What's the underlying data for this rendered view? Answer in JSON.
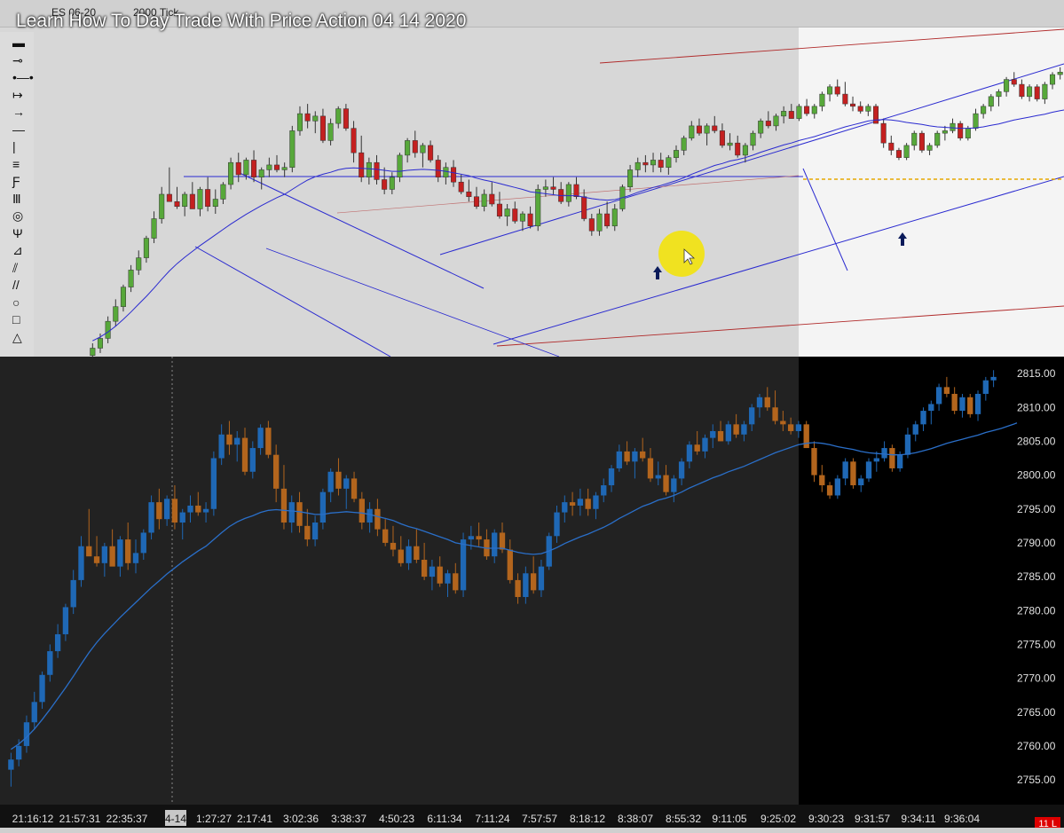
{
  "video_title": "Learn How To Day Trade With Price Action 04 14 2020",
  "toolbar": {
    "instrument": "ES 06-20",
    "bar_type": "2000 Tick"
  },
  "drawing_tools": [
    "rectangle-tool",
    "line-tool",
    "ray-tool",
    "extended-line-tool",
    "arrow-line-tool",
    "horizontal-line-tool",
    "vertical-line-tool",
    "channel-tool",
    "fib-retracement-tool",
    "fib-extension-tool",
    "fib-circle-tool",
    "andrews-pitchfork-tool",
    "gann-fan-tool",
    "regression-tool",
    "parallel-lines-tool",
    "ellipse-tool",
    "rectangle-shape-tool",
    "triangle-tool"
  ],
  "chart_data": {
    "type": "candlestick",
    "title": "",
    "price_axis": {
      "labels": [
        "2815.00",
        "2810.00",
        "2805.00",
        "2800.00",
        "2795.00",
        "2790.00",
        "2785.00",
        "2780.00",
        "2775.00",
        "2770.00",
        "2765.00",
        "2760.00",
        "2755.00"
      ],
      "ylim": [
        2752.0,
        2817.5
      ]
    },
    "time_axis": {
      "labels": [
        "21:16:12",
        "21:57:31",
        "22:35:37",
        "4-14",
        "1:27:27",
        "2:17:41",
        "3:02:36",
        "3:38:37",
        "4:50:23",
        "6:11:34",
        "7:11:24",
        "7:57:57",
        "8:18:12",
        "8:38:07",
        "8:55:32",
        "9:11:05",
        "9:25:02",
        "9:30:23",
        "9:31:57",
        "9:34:11",
        "9:36:04"
      ],
      "highlighted": "4-14"
    },
    "session_break_index": 84,
    "colors": {
      "up": "#1f68b5",
      "down": "#b3651d",
      "ma": "#2a6fc9",
      "session_bg": "#000000"
    },
    "candles": [
      [
        2756.5,
        2759.0,
        2754.0,
        2758.0
      ],
      [
        2758.0,
        2761.0,
        2757.0,
        2760.0
      ],
      [
        2760.0,
        2764.5,
        2759.0,
        2763.5
      ],
      [
        2763.5,
        2768.0,
        2762.5,
        2766.5
      ],
      [
        2766.5,
        2771.0,
        2765.5,
        2770.5
      ],
      [
        2770.5,
        2775.0,
        2769.5,
        2774.0
      ],
      [
        2774.0,
        2778.0,
        2773.0,
        2776.5
      ],
      [
        2776.5,
        2781.0,
        2775.5,
        2780.5
      ],
      [
        2780.5,
        2786.0,
        2779.5,
        2784.5
      ],
      [
        2784.5,
        2791.0,
        2783.5,
        2789.5
      ],
      [
        2789.5,
        2795.0,
        2788.5,
        2788.0
      ],
      [
        2788.0,
        2791.0,
        2786.5,
        2787.0
      ],
      [
        2787.0,
        2790.0,
        2785.0,
        2789.5
      ],
      [
        2789.5,
        2792.0,
        2787.0,
        2786.5
      ],
      [
        2786.5,
        2791.0,
        2785.0,
        2790.5
      ],
      [
        2790.5,
        2793.0,
        2786.0,
        2787.0
      ],
      [
        2787.0,
        2790.5,
        2785.5,
        2788.5
      ],
      [
        2788.5,
        2792.0,
        2787.5,
        2791.5
      ],
      [
        2791.5,
        2797.0,
        2790.5,
        2796.0
      ],
      [
        2796.0,
        2798.0,
        2792.0,
        2793.5
      ],
      [
        2793.5,
        2797.0,
        2792.5,
        2796.5
      ],
      [
        2796.5,
        2798.5,
        2792.0,
        2793.0
      ],
      [
        2793.0,
        2795.0,
        2790.5,
        2794.5
      ],
      [
        2794.5,
        2797.0,
        2793.0,
        2795.5
      ],
      [
        2795.5,
        2797.5,
        2794.0,
        2794.5
      ],
      [
        2794.5,
        2796.0,
        2793.0,
        2795.0
      ],
      [
        2795.0,
        2803.5,
        2794.0,
        2802.5
      ],
      [
        2802.5,
        2807.5,
        2801.5,
        2806.0
      ],
      [
        2806.0,
        2808.0,
        2803.0,
        2804.5
      ],
      [
        2804.5,
        2806.5,
        2802.0,
        2805.5
      ],
      [
        2805.5,
        2807.0,
        2800.0,
        2800.5
      ],
      [
        2800.5,
        2805.0,
        2799.5,
        2804.0
      ],
      [
        2804.0,
        2807.5,
        2803.0,
        2807.0
      ],
      [
        2807.0,
        2808.0,
        2802.5,
        2803.0
      ],
      [
        2803.0,
        2804.5,
        2796.0,
        2798.0
      ],
      [
        2798.0,
        2801.5,
        2792.0,
        2793.0
      ],
      [
        2793.0,
        2797.0,
        2791.5,
        2796.0
      ],
      [
        2796.0,
        2797.5,
        2791.5,
        2792.5
      ],
      [
        2792.5,
        2795.0,
        2789.5,
        2790.5
      ],
      [
        2790.5,
        2794.0,
        2789.5,
        2793.0
      ],
      [
        2793.0,
        2798.0,
        2792.0,
        2797.5
      ],
      [
        2797.5,
        2801.0,
        2796.0,
        2800.5
      ],
      [
        2800.5,
        2802.5,
        2797.0,
        2798.0
      ],
      [
        2798.0,
        2800.0,
        2795.0,
        2799.5
      ],
      [
        2799.5,
        2800.5,
        2796.0,
        2796.5
      ],
      [
        2796.5,
        2797.5,
        2792.0,
        2793.0
      ],
      [
        2793.0,
        2796.0,
        2791.5,
        2795.0
      ],
      [
        2795.0,
        2796.5,
        2791.0,
        2792.0
      ],
      [
        2792.0,
        2793.5,
        2789.5,
        2790.0
      ],
      [
        2790.0,
        2792.5,
        2788.0,
        2789.0
      ],
      [
        2789.0,
        2791.0,
        2786.5,
        2787.0
      ],
      [
        2787.0,
        2790.5,
        2786.0,
        2789.5
      ],
      [
        2789.5,
        2792.0,
        2787.0,
        2787.5
      ],
      [
        2787.5,
        2790.0,
        2784.5,
        2785.0
      ],
      [
        2785.0,
        2787.5,
        2783.0,
        2786.5
      ],
      [
        2786.5,
        2788.0,
        2783.5,
        2784.0
      ],
      [
        2784.0,
        2786.0,
        2782.0,
        2785.5
      ],
      [
        2785.5,
        2787.0,
        2782.5,
        2783.0
      ],
      [
        2783.0,
        2791.5,
        2782.0,
        2790.5
      ],
      [
        2790.5,
        2792.5,
        2789.0,
        2791.0
      ],
      [
        2791.0,
        2793.0,
        2789.5,
        2790.5
      ],
      [
        2790.5,
        2792.0,
        2787.5,
        2788.0
      ],
      [
        2788.0,
        2792.0,
        2787.0,
        2791.5
      ],
      [
        2791.5,
        2793.0,
        2788.5,
        2789.0
      ],
      [
        2789.0,
        2790.5,
        2784.0,
        2784.5
      ],
      [
        2784.5,
        2785.5,
        2781.0,
        2782.0
      ],
      [
        2782.0,
        2786.5,
        2781.0,
        2785.5
      ],
      [
        2785.5,
        2788.0,
        2782.5,
        2783.0
      ],
      [
        2783.0,
        2787.5,
        2782.0,
        2786.5
      ],
      [
        2786.5,
        2791.5,
        2786.0,
        2791.0
      ],
      [
        2791.0,
        2795.5,
        2790.0,
        2794.5
      ],
      [
        2794.5,
        2797.0,
        2793.0,
        2796.0
      ],
      [
        2796.0,
        2797.5,
        2794.0,
        2795.5
      ],
      [
        2795.5,
        2798.0,
        2794.0,
        2796.5
      ],
      [
        2796.5,
        2798.0,
        2794.0,
        2795.0
      ],
      [
        2795.0,
        2797.5,
        2793.5,
        2797.0
      ],
      [
        2797.0,
        2799.5,
        2796.0,
        2798.5
      ],
      [
        2798.5,
        2801.5,
        2797.5,
        2801.0
      ],
      [
        2801.0,
        2804.5,
        2800.5,
        2803.5
      ],
      [
        2803.5,
        2805.0,
        2801.5,
        2802.0
      ],
      [
        2802.0,
        2804.0,
        2799.5,
        2803.5
      ],
      [
        2803.5,
        2805.5,
        2802.0,
        2802.5
      ],
      [
        2802.5,
        2804.0,
        2799.0,
        2799.5
      ],
      [
        2799.5,
        2802.0,
        2798.5,
        2800.0
      ],
      [
        2800.0,
        2801.5,
        2797.0,
        2797.5
      ],
      [
        2797.5,
        2800.0,
        2796.0,
        2799.5
      ],
      [
        2799.5,
        2802.5,
        2798.5,
        2802.0
      ],
      [
        2802.0,
        2805.0,
        2801.0,
        2804.5
      ],
      [
        2804.5,
        2806.5,
        2803.0,
        2803.5
      ],
      [
        2803.5,
        2806.0,
        2802.5,
        2805.5
      ],
      [
        2805.5,
        2807.5,
        2804.0,
        2806.5
      ],
      [
        2806.5,
        2808.0,
        2805.0,
        2805.0
      ],
      [
        2805.0,
        2808.0,
        2804.5,
        2807.5
      ],
      [
        2807.5,
        2809.0,
        2805.5,
        2806.0
      ],
      [
        2806.0,
        2808.0,
        2805.0,
        2807.5
      ],
      [
        2807.5,
        2810.5,
        2806.5,
        2810.0
      ],
      [
        2810.0,
        2812.0,
        2808.5,
        2811.5
      ],
      [
        2811.5,
        2813.0,
        2809.5,
        2810.0
      ],
      [
        2810.0,
        2812.5,
        2807.5,
        2808.0
      ],
      [
        2808.0,
        2809.5,
        2806.5,
        2807.5
      ],
      [
        2807.5,
        2808.5,
        2806.0,
        2806.5
      ],
      [
        2806.5,
        2808.0,
        2805.5,
        2807.5
      ],
      [
        2807.5,
        2808.0,
        2804.0,
        2804.0
      ],
      [
        2804.0,
        2805.0,
        2799.0,
        2800.0
      ],
      [
        2800.0,
        2801.5,
        2797.5,
        2798.5
      ],
      [
        2798.5,
        2799.0,
        2796.5,
        2797.0
      ],
      [
        2797.0,
        2800.0,
        2796.5,
        2799.5
      ],
      [
        2799.5,
        2802.5,
        2798.5,
        2802.0
      ],
      [
        2802.0,
        2802.5,
        2798.0,
        2798.5
      ],
      [
        2798.5,
        2800.0,
        2797.5,
        2799.5
      ],
      [
        2799.5,
        2802.5,
        2799.0,
        2802.0
      ],
      [
        2802.0,
        2803.5,
        2800.5,
        2802.5
      ],
      [
        2802.5,
        2805.0,
        2802.0,
        2804.0
      ],
      [
        2804.0,
        2804.5,
        2800.5,
        2801.0
      ],
      [
        2801.0,
        2803.5,
        2800.5,
        2803.0
      ],
      [
        2803.0,
        2807.0,
        2802.5,
        2806.0
      ],
      [
        2806.0,
        2808.0,
        2805.0,
        2807.5
      ],
      [
        2807.5,
        2810.0,
        2806.5,
        2809.5
      ],
      [
        2809.5,
        2811.0,
        2807.5,
        2810.5
      ],
      [
        2810.5,
        2813.5,
        2809.5,
        2813.0
      ],
      [
        2813.0,
        2814.5,
        2811.5,
        2812.0
      ],
      [
        2812.0,
        2813.0,
        2809.0,
        2809.5
      ],
      [
        2809.5,
        2812.0,
        2808.5,
        2811.5
      ],
      [
        2811.5,
        2812.0,
        2808.5,
        2809.0
      ],
      [
        2809.0,
        2812.5,
        2808.0,
        2812.0
      ],
      [
        2812.0,
        2814.5,
        2811.0,
        2814.0
      ],
      [
        2814.0,
        2815.5,
        2813.0,
        2814.5
      ]
    ],
    "ma_values": [
      2759.5,
      2760.3,
      2761.3,
      2762.5,
      2763.9,
      2765.4,
      2767.0,
      2768.6,
      2770.3,
      2772.1,
      2773.8,
      2775.3,
      2776.6,
      2777.8,
      2779.0,
      2780.1,
      2781.2,
      2782.3,
      2783.4,
      2784.4,
      2785.4,
      2786.3,
      2787.2,
      2788.0,
      2788.8,
      2789.5,
      2790.5,
      2791.5,
      2792.4,
      2793.1,
      2793.6,
      2794.0,
      2794.5,
      2794.8,
      2794.9,
      2794.8,
      2794.7,
      2794.6,
      2794.4,
      2794.2,
      2794.2,
      2794.4,
      2794.5,
      2794.6,
      2794.5,
      2794.4,
      2794.2,
      2793.9,
      2793.6,
      2793.3,
      2792.8,
      2792.4,
      2792.1,
      2791.7,
      2791.3,
      2790.9,
      2790.5,
      2790.0,
      2789.8,
      2789.6,
      2789.4,
      2789.2,
      2789.2,
      2789.2,
      2788.9,
      2788.6,
      2788.4,
      2788.3,
      2788.4,
      2788.8,
      2789.3,
      2789.9,
      2790.4,
      2790.9,
      2791.3,
      2791.8,
      2792.3,
      2792.9,
      2793.6,
      2794.2,
      2794.8,
      2795.4,
      2795.8,
      2796.3,
      2796.6,
      2797.0,
      2797.5,
      2798.1,
      2798.6,
      2799.1,
      2799.6,
      2800.0,
      2800.5,
      2800.9,
      2801.3,
      2801.8,
      2802.3,
      2802.8,
      2803.3,
      2803.7,
      2804.1,
      2804.5,
      2804.7,
      2804.8,
      2804.7,
      2804.5,
      2804.2,
      2804.0,
      2803.8,
      2803.5,
      2803.3,
      2803.2,
      2803.1,
      2803.0,
      2803.0,
      2803.1,
      2803.3,
      2803.6,
      2803.9,
      2804.3,
      2804.7,
      2805.0,
      2805.3,
      2805.6,
      2805.9,
      2806.3,
      2806.6,
      2806.9,
      2807.3,
      2807.7
    ]
  },
  "top_panel": {
    "colors": {
      "up": "#57a83a",
      "down": "#c42020",
      "channel": "#2a2ad0",
      "trend": "#b02a2a",
      "highlight": "#f5e400"
    }
  },
  "badge": "11 L"
}
